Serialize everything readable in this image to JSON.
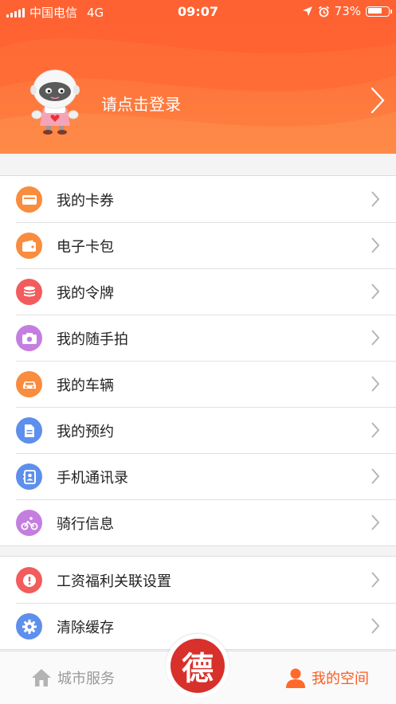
{
  "status_bar": {
    "carrier": "中国电信",
    "network": "4G",
    "time": "09:07",
    "battery": "73%",
    "battery_level": 0.73
  },
  "profile": {
    "login_prompt": "请点击登录",
    "avatar_icon": "robot-mascot-icon"
  },
  "menu_group_1": [
    {
      "label": "我的卡券",
      "icon": "ticket-icon",
      "color": "#f98c3e"
    },
    {
      "label": "电子卡包",
      "icon": "wallet-icon",
      "color": "#f98c3e"
    },
    {
      "label": "我的令牌",
      "icon": "coin-stack-icon",
      "color": "#f25c5c"
    },
    {
      "label": "我的随手拍",
      "icon": "camera-icon",
      "color": "#c47ee0"
    },
    {
      "label": "我的车辆",
      "icon": "car-icon",
      "color": "#f98c3e"
    },
    {
      "label": "我的预约",
      "icon": "document-icon",
      "color": "#5d8fec"
    },
    {
      "label": "手机通讯录",
      "icon": "contacts-icon",
      "color": "#5d8fec"
    },
    {
      "label": "骑行信息",
      "icon": "bicycle-icon",
      "color": "#c47ee0"
    }
  ],
  "menu_group_2": [
    {
      "label": "工资福利关联设置",
      "icon": "alert-icon",
      "color": "#f25c5c"
    },
    {
      "label": "清除缓存",
      "icon": "gear-icon",
      "color": "#5d8fec"
    }
  ],
  "tabbar": {
    "city_services": "城市服务",
    "center_logo_char": "德",
    "my_space": "我的空间"
  },
  "colors": {
    "header": "#ff6a36",
    "active_tab": "#ff5a1f",
    "inactive_tab": "#999999"
  }
}
